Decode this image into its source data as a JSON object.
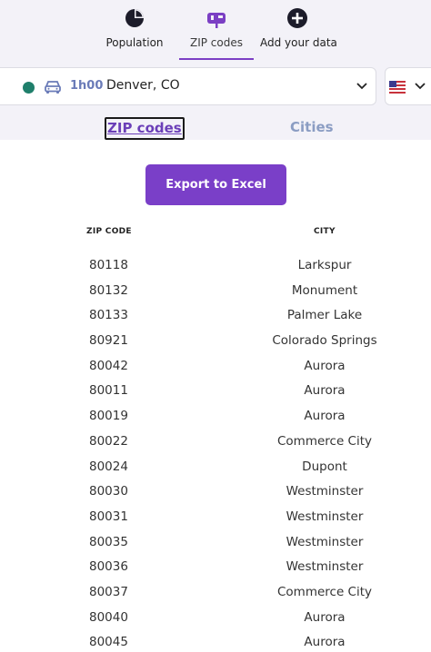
{
  "nav": {
    "tabs": [
      {
        "label": "Population",
        "icon": "pie-chart-icon"
      },
      {
        "label": "ZIP codes",
        "icon": "mailbox-icon"
      },
      {
        "label": "Add your data",
        "icon": "plus-circle-icon"
      }
    ],
    "active_tab": "ZIP codes",
    "accent": "#7b3fc4"
  },
  "search": {
    "drive_time": "1h00",
    "location": "Denver, CO",
    "status_color": "#1f7f6b",
    "country": "United States"
  },
  "subtabs": {
    "zip_label": "ZIP codes",
    "cities_label": "Cities",
    "active": "ZIP codes"
  },
  "export": {
    "label": "Export to Excel"
  },
  "table": {
    "headers": {
      "zip": "ZIP CODE",
      "city": "CITY"
    },
    "rows": [
      {
        "zip": "80118",
        "city": "Larkspur"
      },
      {
        "zip": "80132",
        "city": "Monument"
      },
      {
        "zip": "80133",
        "city": "Palmer Lake"
      },
      {
        "zip": "80921",
        "city": "Colorado Springs"
      },
      {
        "zip": "80042",
        "city": "Aurora"
      },
      {
        "zip": "80011",
        "city": "Aurora"
      },
      {
        "zip": "80019",
        "city": "Aurora"
      },
      {
        "zip": "80022",
        "city": "Commerce City"
      },
      {
        "zip": "80024",
        "city": "Dupont"
      },
      {
        "zip": "80030",
        "city": "Westminster"
      },
      {
        "zip": "80031",
        "city": "Westminster"
      },
      {
        "zip": "80035",
        "city": "Westminster"
      },
      {
        "zip": "80036",
        "city": "Westminster"
      },
      {
        "zip": "80037",
        "city": "Commerce City"
      },
      {
        "zip": "80040",
        "city": "Aurora"
      },
      {
        "zip": "80045",
        "city": "Aurora"
      }
    ]
  }
}
